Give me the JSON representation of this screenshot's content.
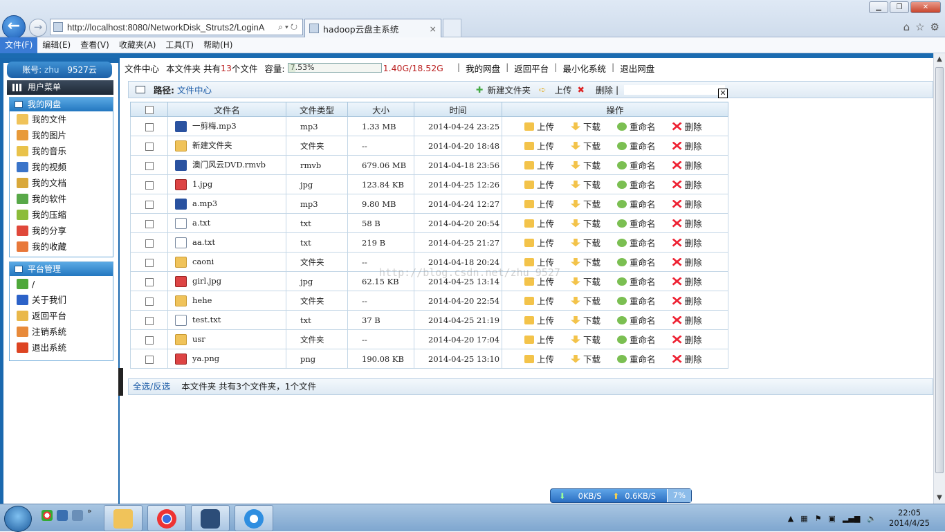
{
  "browser": {
    "address": "http://localhost:8080/NetworkDisk_Struts2/LoginA",
    "tab_title": "hadoop云盘主系统",
    "tab_close": "×",
    "menu": [
      "文件(F)",
      "编辑(E)",
      "查看(V)",
      "收藏夹(A)",
      "工具(T)",
      "帮助(H)"
    ]
  },
  "sidebar": {
    "account_label": "账号:",
    "account_user": "zhu",
    "account_suffix": "9527云",
    "user_menu": "用户菜单",
    "disk_header": "我的网盘",
    "disk_items": [
      {
        "label": "我的文件",
        "color": "#f0c35a"
      },
      {
        "label": "我的图片",
        "color": "#e89a3a"
      },
      {
        "label": "我的音乐",
        "color": "#e9c24a"
      },
      {
        "label": "我的视频",
        "color": "#3a74c9"
      },
      {
        "label": "我的文档",
        "color": "#d9a83a"
      },
      {
        "label": "我的软件",
        "color": "#58a848"
      },
      {
        "label": "我的压缩",
        "color": "#8cbc3a"
      },
      {
        "label": "我的分享",
        "color": "#e0483a"
      },
      {
        "label": "我的收藏",
        "color": "#e8783a"
      }
    ],
    "platform_header": "平台管理",
    "platform_items": [
      {
        "label": "/",
        "color": "#4fa83a"
      },
      {
        "label": "关于我们",
        "color": "#2c62c8"
      },
      {
        "label": "返回平台",
        "color": "#e9b84a"
      },
      {
        "label": "注销系统",
        "color": "#e88a3a"
      },
      {
        "label": "退出系统",
        "color": "#d42"
      }
    ]
  },
  "infobar": {
    "file_center": "文件中心",
    "folder_info_prefix": "本文件夹 共有",
    "folder_count": "13",
    "folder_info_suffix": "个文件",
    "capacity_label": "容量:",
    "capacity_percent": "7.53%",
    "capacity_fraction": 0.0753,
    "capacity_used": "1.40G/18.52G",
    "links": [
      "我的网盘",
      "返回平台",
      "最小化系统",
      "退出网盘"
    ]
  },
  "pathbar": {
    "path_label": "路径:",
    "path_value": "文件中心",
    "new_folder": "新建文件夹",
    "upload": "上传",
    "delete": "删除"
  },
  "table": {
    "headers": [
      "文件名",
      "文件类型",
      "大小",
      "时间",
      "操作"
    ],
    "op_labels": {
      "upload": "上传",
      "download": "下载",
      "rename": "重命名",
      "delete": "删除"
    },
    "rows": [
      {
        "name": "一剪梅.mp3",
        "kind": "mp3",
        "type": "mp3",
        "size": "1.33 MB",
        "time": "2014-04-24 23:25"
      },
      {
        "name": "新建文件夹",
        "kind": "dir",
        "type": "文件夹",
        "size": "--",
        "time": "2014-04-20 18:48"
      },
      {
        "name": "澳门风云DVD.rmvb",
        "kind": "mp3",
        "type": "rmvb",
        "size": "679.06 MB",
        "time": "2014-04-18 23:56"
      },
      {
        "name": "1.jpg",
        "kind": "img",
        "type": "jpg",
        "size": "123.84 KB",
        "time": "2014-04-25 12:26"
      },
      {
        "name": "a.mp3",
        "kind": "mp3",
        "type": "mp3",
        "size": "9.80 MB",
        "time": "2014-04-24 12:27"
      },
      {
        "name": "a.txt",
        "kind": "txt",
        "type": "txt",
        "size": "58 B",
        "time": "2014-04-20 20:54"
      },
      {
        "name": "aa.txt",
        "kind": "txt",
        "type": "txt",
        "size": "219 B",
        "time": "2014-04-25 21:27"
      },
      {
        "name": "caoni",
        "kind": "dir",
        "type": "文件夹",
        "size": "--",
        "time": "2014-04-18 20:24"
      },
      {
        "name": "girl.jpg",
        "kind": "img",
        "type": "jpg",
        "size": "62.15 KB",
        "time": "2014-04-25 13:14"
      },
      {
        "name": "hehe",
        "kind": "dir",
        "type": "文件夹",
        "size": "--",
        "time": "2014-04-20 22:54"
      },
      {
        "name": "test.txt",
        "kind": "txt",
        "type": "txt",
        "size": "37 B",
        "time": "2014-04-25 21:19"
      },
      {
        "name": "usr",
        "kind": "dir",
        "type": "文件夹",
        "size": "--",
        "time": "2014-04-20 17:04"
      },
      {
        "name": "ya.png",
        "kind": "img",
        "type": "png",
        "size": "190.08 KB",
        "time": "2014-04-25 13:10"
      }
    ]
  },
  "footer": {
    "select_all": "全选/反选",
    "summary": "本文件夹 共有3个文件夹，1个文件"
  },
  "watermark": "http://blog.csdn.net/zhu_9527",
  "speed_widget": {
    "down": "0KB/S",
    "up": "0.6KB/S",
    "percent": "7%"
  },
  "taskbar": {
    "time": "22:05",
    "date": "2014/4/25"
  }
}
